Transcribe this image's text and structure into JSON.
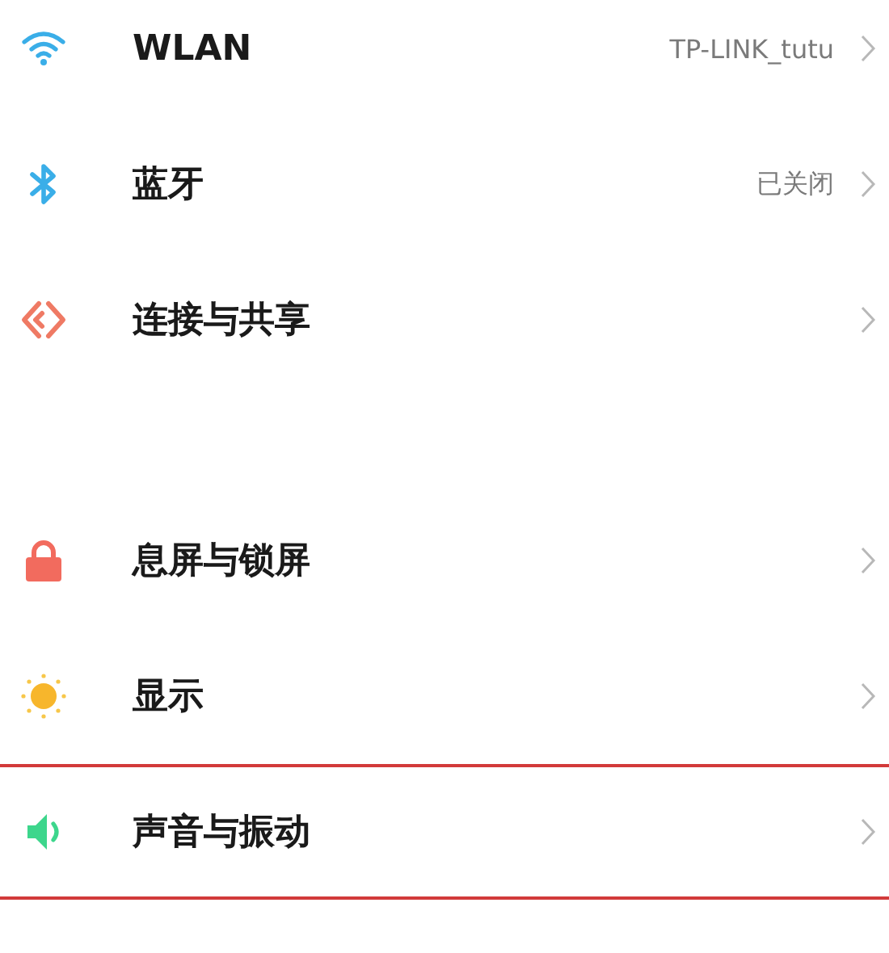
{
  "groups": [
    {
      "items": [
        {
          "label": "WLAN",
          "value": "TP-LINK_tutu",
          "highlighted": false
        },
        {
          "label": "蓝牙",
          "value": "已关闭",
          "highlighted": false
        },
        {
          "label": "连接与共享",
          "highlighted": false
        }
      ]
    },
    {
      "items": [
        {
          "label": "息屏与锁屏",
          "highlighted": false
        },
        {
          "label": "显示",
          "highlighted": false
        },
        {
          "label": "声音与振动",
          "highlighted": true
        }
      ]
    }
  ]
}
